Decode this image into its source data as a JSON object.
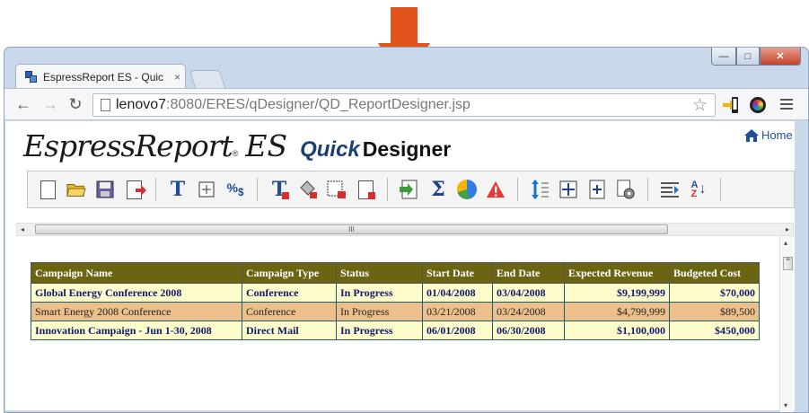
{
  "browser": {
    "tab_title": "EspressReport ES - Quic",
    "tab_close": "×",
    "url_host": "lenovo7",
    "url_rest": ":8080/ERES/qDesigner/QD_ReportDesigner.jsp",
    "window_controls": {
      "minimize": "—",
      "maximize": "□",
      "close": "✕"
    },
    "nav": {
      "back": "←",
      "forward": "→",
      "reload": "↻"
    },
    "star": "☆"
  },
  "app": {
    "logo_main": "EspressReport",
    "logo_reg": "®",
    "logo_es": "ES",
    "logo_quick": "Quick",
    "logo_designer": "Designer",
    "home_label": "Home"
  },
  "report_toolbar": {
    "icons": [
      "new-report-icon",
      "open-icon",
      "save-icon",
      "export-icon",
      "insert-text-icon",
      "insert-cell-icon",
      "format-number-icon",
      "text-format-icon",
      "fill-color-icon",
      "border-icon",
      "page-setup-icon",
      "data-source-icon",
      "summary-icon",
      "chart-icon",
      "alert-icon",
      "row-height-icon",
      "move-icon",
      "resize-icon",
      "settings-icon",
      "group-icon",
      "sort-icon"
    ]
  },
  "scroll": {
    "grip": "III",
    "left": "◂",
    "right": "▸",
    "up": "▴",
    "down": "▾",
    "vgrip": "≡"
  },
  "report": {
    "columns": [
      "Campaign Name",
      "Campaign Type",
      "Status",
      "Start Date",
      "End Date",
      "Expected Revenue",
      "Budgeted Cost"
    ],
    "rows": [
      [
        "Global Energy Conference 2008",
        "Conference",
        "In Progress",
        "01/04/2008",
        "03/04/2008",
        "$9,199,999",
        "$70,000"
      ],
      [
        "Smart Energy 2008 Conference",
        "Conference",
        "In Progress",
        "03/21/2008",
        "03/24/2008",
        "$4,799,999",
        "$89,500"
      ],
      [
        "Innovation Campaign - Jun 1-30, 2008",
        "Direct Mail",
        "In Progress",
        "06/01/2008",
        "06/30/2008",
        "$1,100,000",
        "$450,000"
      ]
    ]
  },
  "colors": {
    "header_bg": "#6b6511",
    "row_odd": "#fffccc",
    "row_even": "#edc08b",
    "arrow": "#e0531c"
  }
}
